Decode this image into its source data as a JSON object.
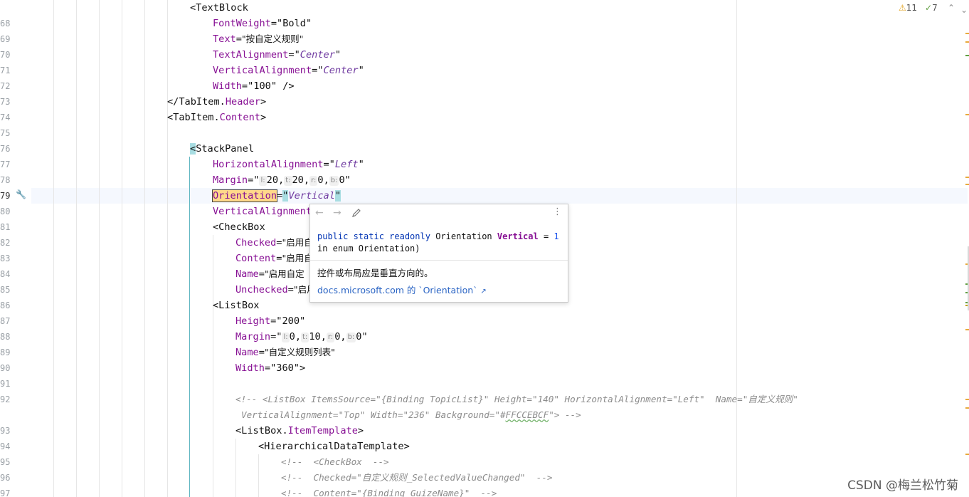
{
  "status": {
    "warnings": "11",
    "checks": "7"
  },
  "gutter": [
    "68",
    "69",
    "70",
    "71",
    "72",
    "73",
    "74",
    "75",
    "76",
    "77",
    "78",
    "79",
    "80",
    "81",
    "82",
    "83",
    "84",
    "85",
    "86",
    "87",
    "88",
    "89",
    "90",
    "91",
    "92",
    "",
    "93",
    "94",
    "95",
    "96",
    "97"
  ],
  "code": {
    "l67_tag": "<TextBlock",
    "l68_attr": "FontWeight",
    "l68_val": "\"Bold\"",
    "l69_attr": "Text",
    "l69_val": "\"按自定义规则\"",
    "l70_attr": "TextAlignment",
    "l70_val": "Center",
    "l71_attr": "VerticalAlignment",
    "l71_val": "Center",
    "l72_attr": "Width",
    "l72_val": "\"100\" />",
    "l73_a": "</TabItem.",
    "l73_b": "Header",
    "l73_c": ">",
    "l74_a": "<TabItem.",
    "l74_b": "Content",
    "l74_c": ">",
    "l76_tag": "StackPanel",
    "l77_attr": "HorizontalAlignment",
    "l77_val": "Left",
    "l78_attr": "Margin",
    "l78_hints": [
      "l:",
      "t:",
      "r:",
      "b:"
    ],
    "l78_vals": [
      "20",
      "20",
      "0",
      "0"
    ],
    "l79_attr": "Orientation",
    "l79_val": "Vertical",
    "l80_attr": "VerticalAlignment",
    "l81_tag": "<CheckBox",
    "l82_attr": "Checked",
    "l82_val": "\"启用自",
    "l83_attr": "Content",
    "l83_val": "\"启用自",
    "l84_attr": "Name",
    "l84_val": "\"启用自定",
    "l85_attr": "Unchecked",
    "l85_val": "\"启用",
    "l86_tag": "<ListBox",
    "l87_attr": "Height",
    "l87_val": "\"200\"",
    "l88_attr": "Margin",
    "l88_hints": [
      "l:",
      "t:",
      "r:",
      "b:"
    ],
    "l88_vals": [
      "0",
      "10",
      "0",
      "0"
    ],
    "l89_attr": "Name",
    "l89_val": "\"自定义规则列表\"",
    "l90_attr": "Width",
    "l90_val": "\"360\">",
    "l92_comment": "<!-- <ListBox ItemsSource=\"{Binding TopicList}\" Height=\"140\" HorizontalAlignment=\"Left\"  Name=\"自定义规则\"",
    "l92b_comment_a": "VerticalAlignment=\"Top\" Width=\"236\" Background=\"#",
    "l92b_comment_b": "FFCCEBCF",
    "l92b_comment_c": "\"> -->",
    "l93_a": "<ListBox.",
    "l93_b": "ItemTemplate",
    "l93_c": ">",
    "l94_tag": "<HierarchicalDataTemplate>",
    "l95_comment": "<!--  <CheckBox  -->",
    "l96_comment": "<!--  Checked=\"自定义规则_SelectedValueChanged\"  -->",
    "l97_comment": "<!--  Content=\"{Binding GuizeName}\"  -->"
  },
  "popup": {
    "sig_kw": "public static readonly",
    "sig_type": "Orientation",
    "sig_name": "Vertical",
    "sig_eq": "=",
    "sig_num": "1",
    "sig_line2": "in enum Orientation)",
    "description": "控件或布局应是垂直方向的。",
    "link": "docs.microsoft.com 的 `Orientation`",
    "back_icon": "arrow-left-icon",
    "forward_icon": "arrow-right-icon",
    "edit_icon": "pencil-icon",
    "more_icon": "more-vertical-icon"
  },
  "watermark": "CSDN @梅兰松竹菊"
}
